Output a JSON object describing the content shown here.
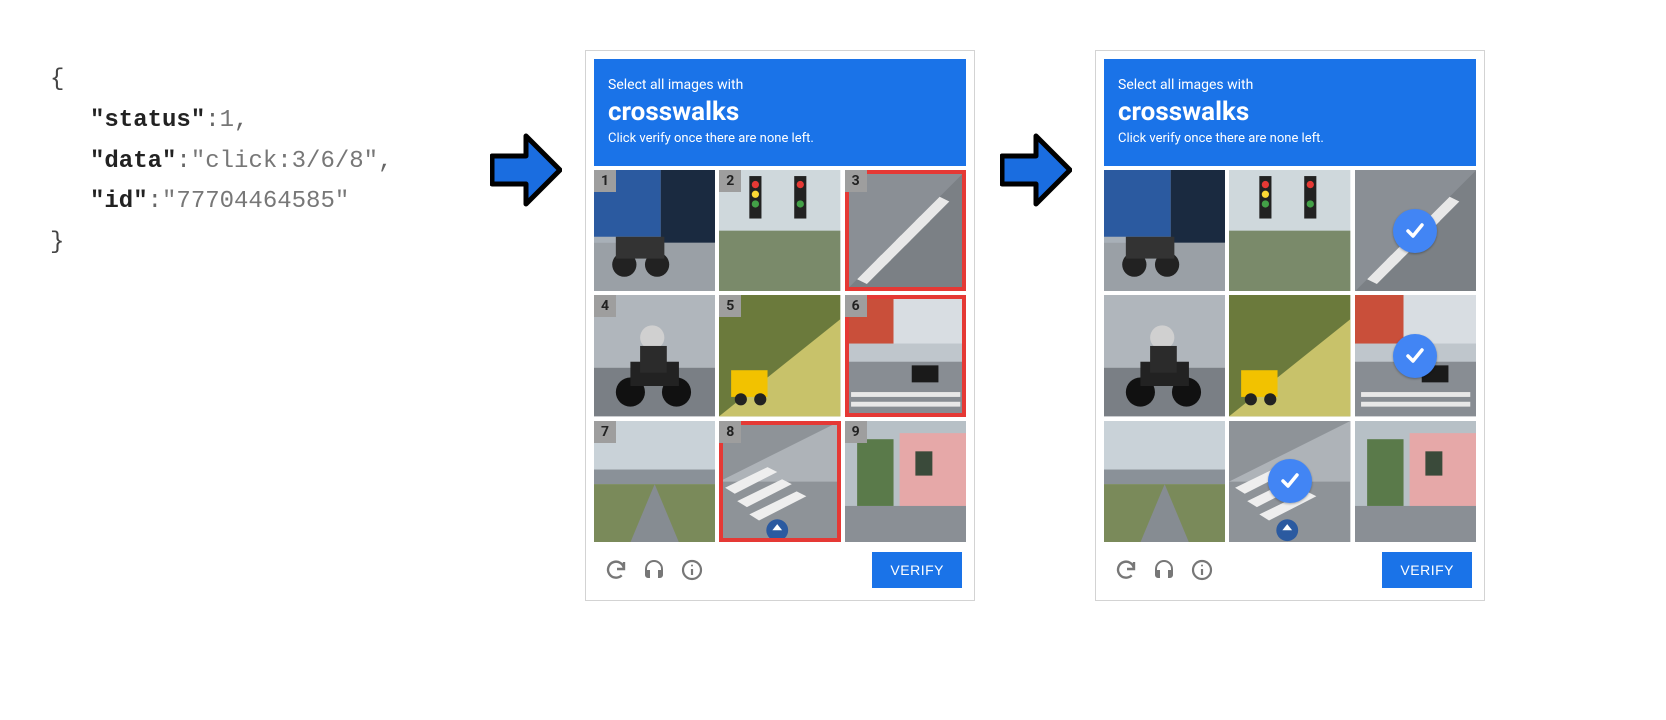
{
  "json_snippet": {
    "status_key": "\"status\"",
    "status_val": "1",
    "data_key": "\"data\"",
    "data_val": "\"click:3/6/8\"",
    "id_key": "\"id\"",
    "id_val": "\"77704464585\""
  },
  "captcha": {
    "prompt_line1": "Select all images with",
    "prompt_subject": "crosswalks",
    "prompt_line3": "Click verify once there are none left.",
    "verify_label": "VERIFY",
    "tiles_left": [
      {
        "n": "1",
        "highlight": false
      },
      {
        "n": "2",
        "highlight": false
      },
      {
        "n": "3",
        "highlight": true
      },
      {
        "n": "4",
        "highlight": false
      },
      {
        "n": "5",
        "highlight": false
      },
      {
        "n": "6",
        "highlight": true
      },
      {
        "n": "7",
        "highlight": false
      },
      {
        "n": "8",
        "highlight": true
      },
      {
        "n": "9",
        "highlight": false
      }
    ],
    "tiles_right": [
      {
        "checked": false
      },
      {
        "checked": false
      },
      {
        "checked": true
      },
      {
        "checked": false
      },
      {
        "checked": false
      },
      {
        "checked": true
      },
      {
        "checked": false
      },
      {
        "checked": true
      },
      {
        "checked": false
      }
    ]
  }
}
